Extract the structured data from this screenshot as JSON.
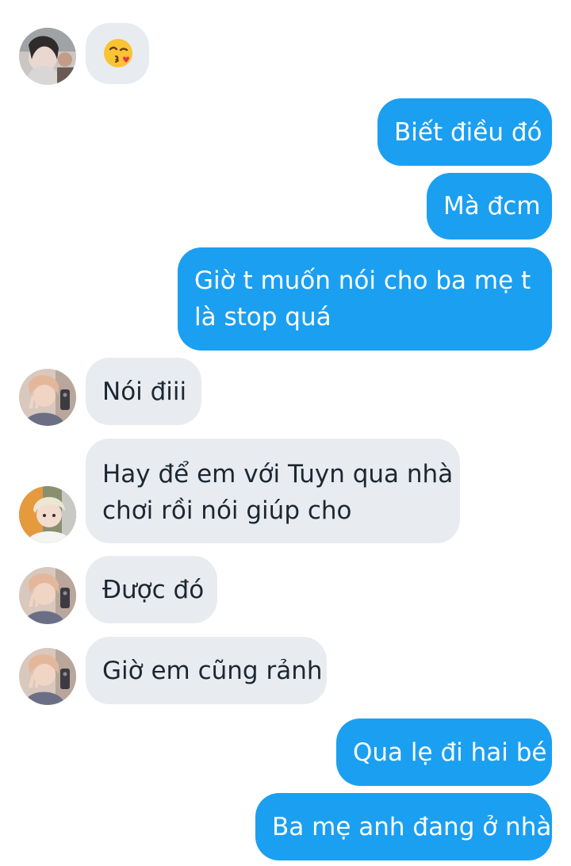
{
  "conversation": {
    "messages": [
      {
        "sender": "other",
        "text": "😘",
        "avatar": "avatar-user-hoodie"
      },
      {
        "sender": "me",
        "text": "Biết điều đó"
      },
      {
        "sender": "me",
        "text": "Mà đcm"
      },
      {
        "sender": "me",
        "text": "Giờ t muốn nói cho ba mẹ t",
        "text2": "là stop quá"
      },
      {
        "sender": "other",
        "text": "Nói điii",
        "avatar": "avatar-user-peace"
      },
      {
        "sender": "other",
        "text": "Hay để em với Tuyn qua nhà",
        "text2": "chơi rồi nói giúp cho",
        "avatar": "avatar-user-blond"
      },
      {
        "sender": "other",
        "text": "Được đó",
        "avatar": "avatar-user-peace"
      },
      {
        "sender": "other",
        "text": "Giờ em cũng rảnh",
        "avatar": "avatar-user-peace"
      },
      {
        "sender": "me",
        "text": "Qua lẹ đi hai bé"
      },
      {
        "sender": "me",
        "text": "Ba mẹ anh đang ở nhà"
      }
    ]
  },
  "colors": {
    "incoming_bubble": "#e8ecf0",
    "incoming_text": "#1d2733",
    "outgoing_bubble": "#1b9ff1",
    "outgoing_text": "#ffffff",
    "background": "#ffffff"
  },
  "icons": {
    "kiss_emoji": "face-blowing-a-kiss-icon"
  }
}
